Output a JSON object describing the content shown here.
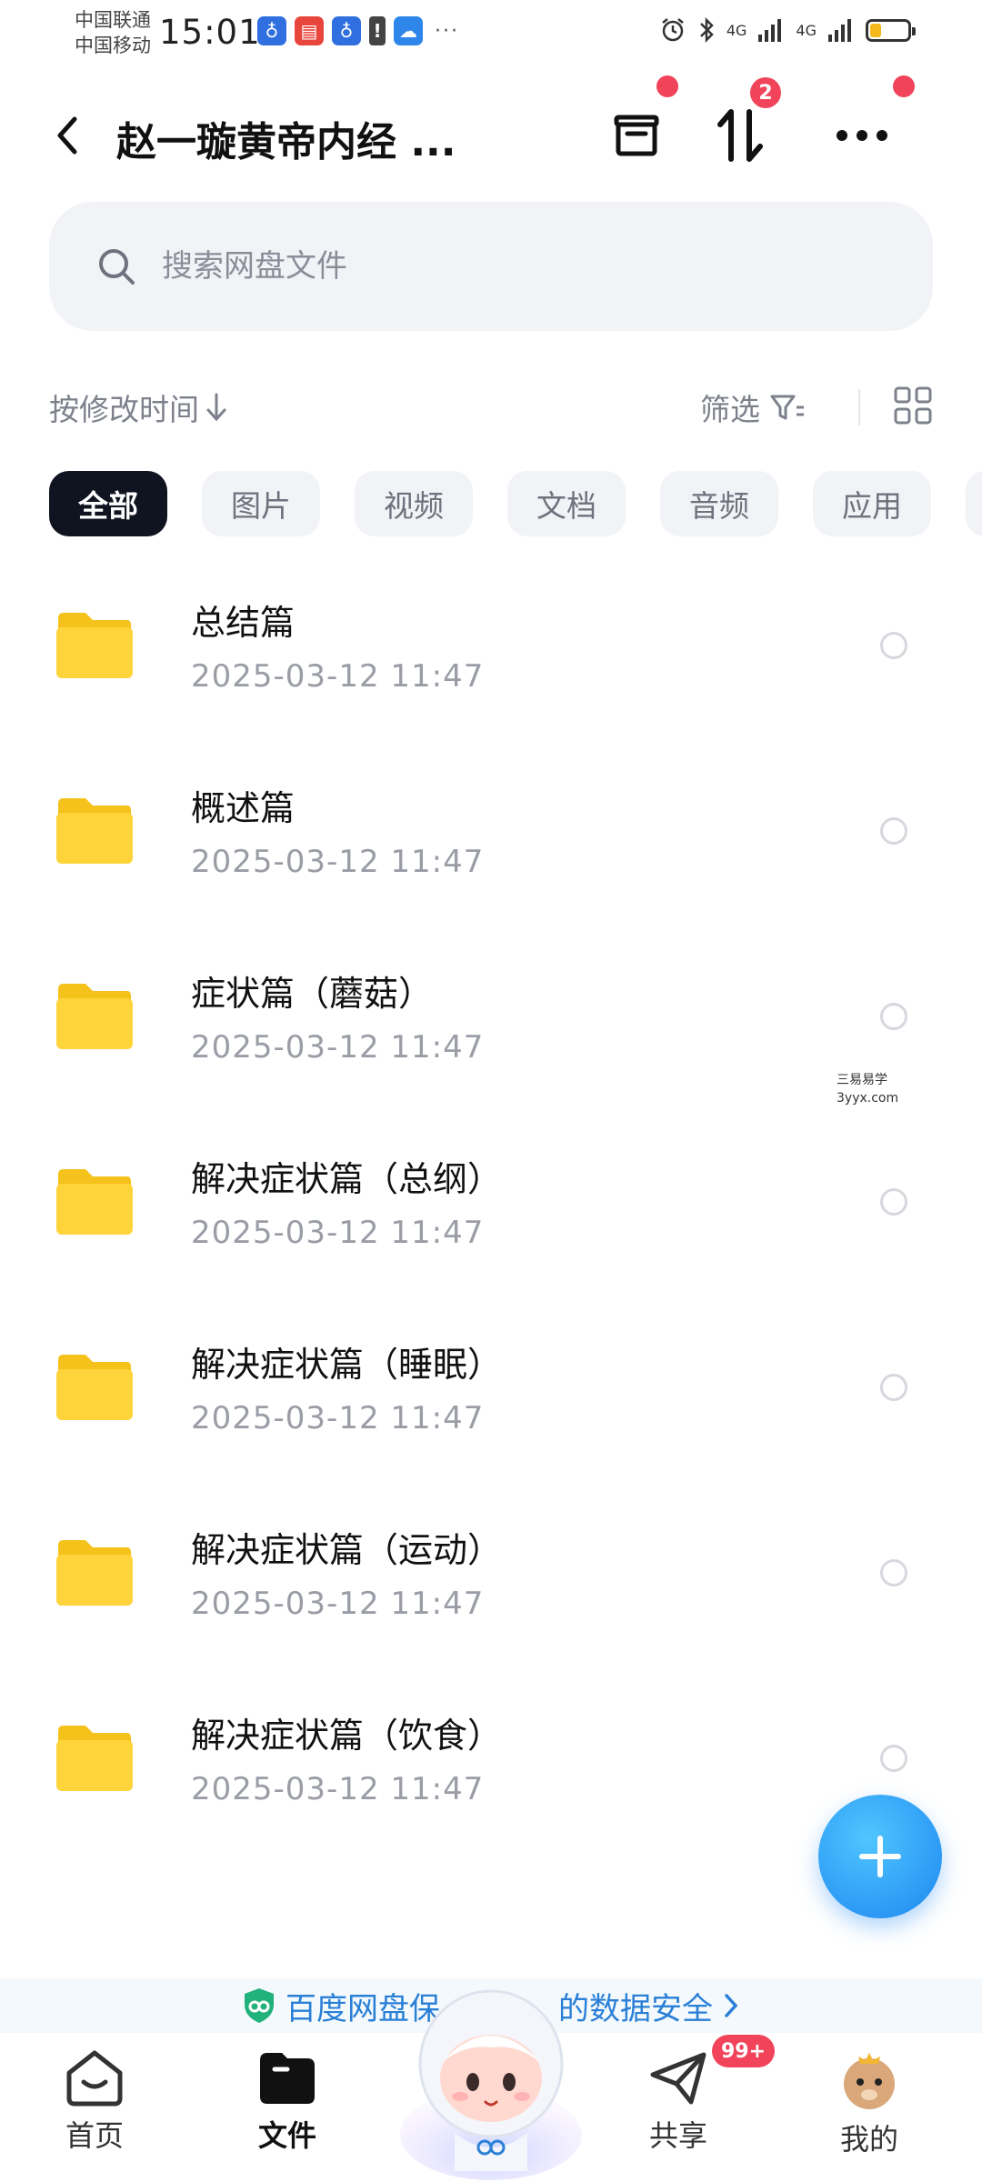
{
  "status_bar": {
    "carrier_1": "中国联通",
    "carrier_2": "中国移动",
    "time": "15:01",
    "network_1": "4G",
    "network_2": "4G",
    "battery_level": 0.3
  },
  "header": {
    "title": "赵一璇黄帝内经 ...",
    "transfer_badge": "2"
  },
  "search": {
    "placeholder": "搜索网盘文件"
  },
  "sort_bar": {
    "sort_label": "按修改时间",
    "filter_label": "筛选"
  },
  "chips": [
    "全部",
    "图片",
    "视频",
    "文档",
    "音频",
    "应用"
  ],
  "files": [
    {
      "name": "总结篇",
      "date": "2025-03-12  11:47"
    },
    {
      "name": "概述篇",
      "date": "2025-03-12  11:47"
    },
    {
      "name": "症状篇（蘑菇）",
      "date": "2025-03-12  11:47"
    },
    {
      "name": "解决症状篇（总纲）",
      "date": "2025-03-12  11:47"
    },
    {
      "name": "解决症状篇（睡眠）",
      "date": "2025-03-12  11:47"
    },
    {
      "name": "解决症状篇（运动）",
      "date": "2025-03-12  11:47"
    },
    {
      "name": "解决症状篇（饮食）",
      "date": "2025-03-12  11:47"
    }
  ],
  "watermark": {
    "line1": "三易易学",
    "line2": "3yyx.com"
  },
  "safety_banner": {
    "text_left": "百度网盘保",
    "text_right": "的数据安全"
  },
  "bottom_nav": {
    "home": "首页",
    "files": "文件",
    "share": "共享",
    "share_badge": "99+",
    "mine": "我的"
  },
  "colors": {
    "accent_blue": "#1e86f0",
    "badge_red": "#f1435a",
    "folder_yellow": "#ffd43b",
    "chip_active": "#0f1420"
  }
}
